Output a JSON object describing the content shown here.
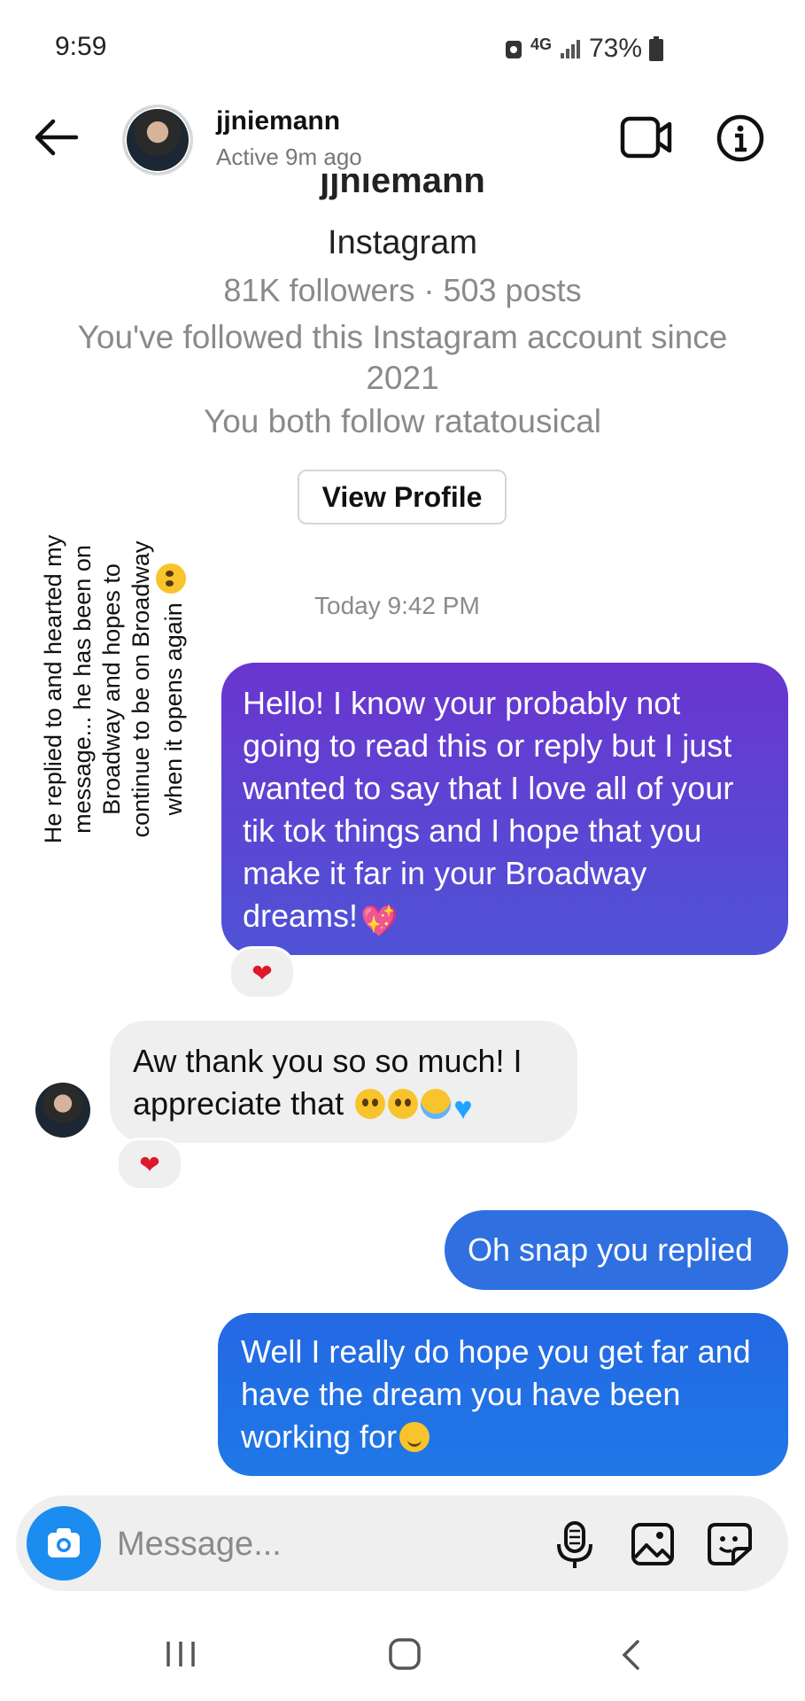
{
  "status_bar": {
    "time": "9:59",
    "network": "4G",
    "battery": "73%"
  },
  "header": {
    "username": "jjniemann",
    "active_status": "Active 9m ago"
  },
  "profile": {
    "name_cut": "jjniemann",
    "platform": "Instagram",
    "stats": "81K followers · 503 posts",
    "followed_since": "You've followed this Instagram account since\n2021",
    "mutual": "You both follow ratatousical",
    "view_profile_label": "View Profile"
  },
  "note": "He replied to and hearted my\nmessage... he has been on\nBroadway and hopes to\ncontinue to be on Broadway\nwhen it opens again",
  "timestamp": "Today 9:42 PM",
  "messages": [
    {
      "sender": "me",
      "text": "Hello! I know your probably not going to read this or reply but I just wanted to say that I love all of your tik tok things and I hope that you make it far in your Broadway dreams!",
      "reaction": "❤"
    },
    {
      "sender": "jjniemann",
      "text": "Aw thank you so so much! I appreciate that",
      "reaction": "❤"
    },
    {
      "sender": "me",
      "text": "Oh snap you replied"
    },
    {
      "sender": "me",
      "text": "Well I really do hope you get far and have the dream you have been working for"
    }
  ],
  "composer": {
    "placeholder": "Message..."
  },
  "colors": {
    "accent": "#1b8cf0",
    "sent_bubble": "#2f6fe0",
    "purple_bubble": "#6a35cf"
  }
}
